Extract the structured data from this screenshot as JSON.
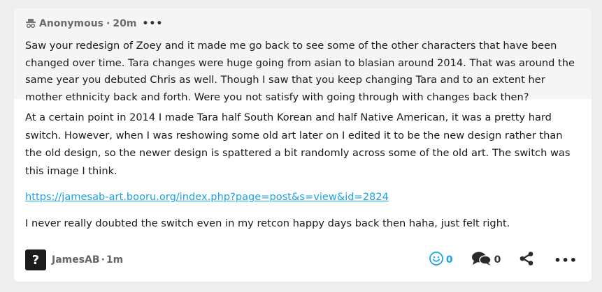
{
  "question": {
    "author": "Anonymous",
    "separator": "·",
    "time": "20m",
    "menu_icon": "more-dots-icon",
    "text": "Saw your redesign of Zoey and it made me go back to see some of the other characters that have been changed over time. Tara changes were huge going from asian to blasian around 2014. That was around the same year you debuted Chris as well. Though I saw that you keep changing Tara and to an extent her mother ethnicity back and forth. Were you not satisfy with going through with changes back then?"
  },
  "answer": {
    "text": "At a certain point in 2014 I made Tara half South Korean and half Native American, it was a pretty hard switch. However, when I was reshowing some old art later on I edited it to be the new design rather than the old design, so the newer design is spattered a bit randomly across some of the old art. The switch was this image I think.",
    "link": "https://jamesab-art.booru.org/index.php?page=post&s=view&id=2824",
    "outro": "I never really doubted the switch even in my retcon happy days back then haha, just felt right."
  },
  "footer": {
    "avatar_glyph": "?",
    "author": "JamesAB",
    "separator": "·",
    "time": "1m",
    "smiles_count": "0",
    "comments_count": "0"
  },
  "colors": {
    "accent": "#1aa3e6",
    "question_bg": "#f5f5f5",
    "page_bg": "#eeeeee"
  }
}
